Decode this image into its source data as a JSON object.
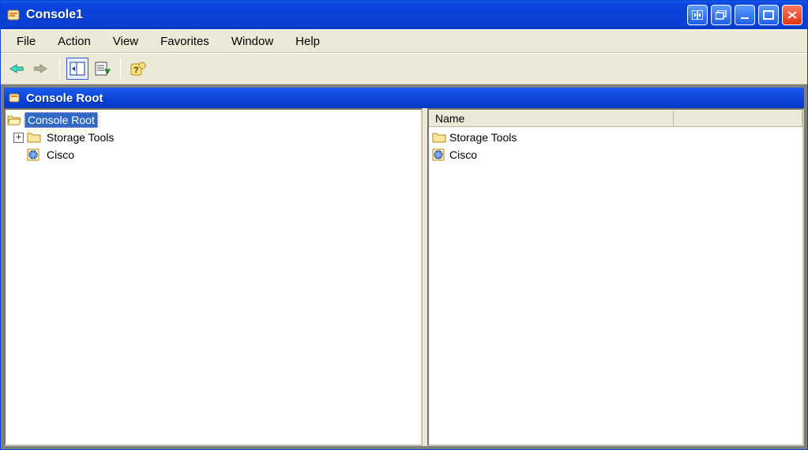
{
  "app": {
    "title": "Console1"
  },
  "menu": {
    "items": [
      "File",
      "Action",
      "View",
      "Favorites",
      "Window",
      "Help"
    ]
  },
  "panel": {
    "title": "Console Root"
  },
  "tree": {
    "root": {
      "label": "Console Root",
      "selected": true
    },
    "children": [
      {
        "label": "Storage Tools",
        "expandable": true,
        "icon": "folder"
      },
      {
        "label": "Cisco",
        "expandable": false,
        "icon": "globe"
      }
    ]
  },
  "list": {
    "columns": [
      "Name"
    ],
    "rows": [
      {
        "label": "Storage Tools",
        "icon": "folder"
      },
      {
        "label": "Cisco",
        "icon": "globe"
      }
    ]
  }
}
